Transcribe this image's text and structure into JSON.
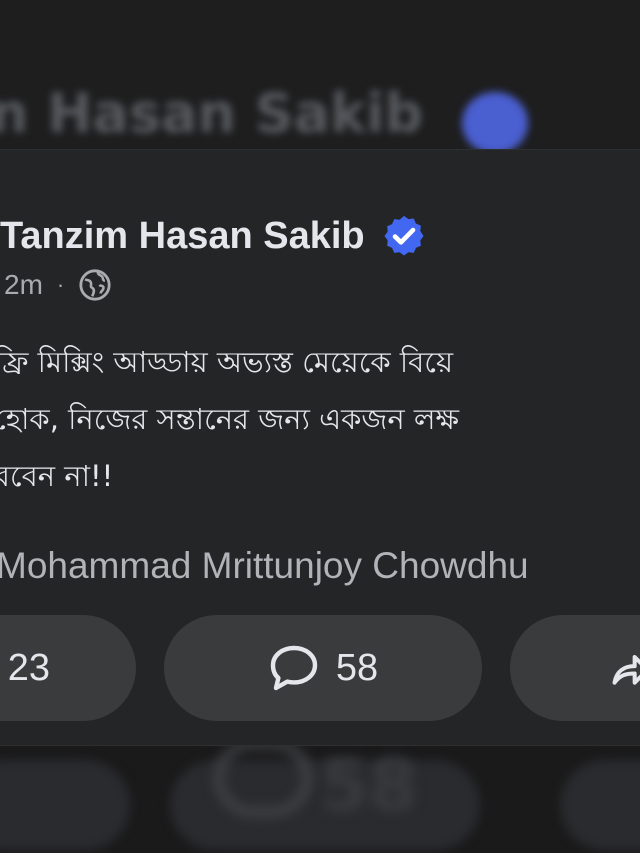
{
  "background": {
    "blurred_name": "n Hasan Sakib",
    "blurred_counter": "58"
  },
  "post": {
    "author": "Tanzim Hasan Sakib",
    "verified": true,
    "time": "2m",
    "separator": "·",
    "privacy_icon": "globe-icon",
    "text_lines": [
      "ফ্রি মিক্সিং আড্ডায় অভ্যস্ত মেয়েকে বিয়ে",
      "হোক, নিজের সন্তানের জন্য একজন লক্ষ",
      "রবেন না!!"
    ],
    "mention": "Mohammad Mrittunjoy Chowdhu"
  },
  "actions": {
    "like_count": "23",
    "comment_count": "58",
    "comment_icon": "comment-bubble-icon",
    "share_icon": "share-arrow-icon"
  },
  "colors": {
    "card": "#242526",
    "pill": "#3a3b3c",
    "text": "#e4e6eb",
    "muted": "#a8abb0",
    "verified_badge": "#4267f0"
  }
}
